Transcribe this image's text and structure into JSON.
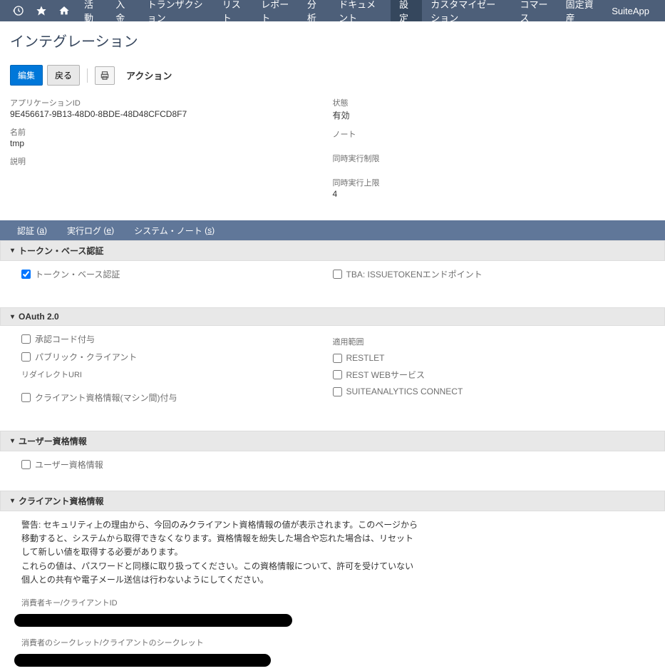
{
  "nav": {
    "items": [
      "活動",
      "入金",
      "トランザクション",
      "リスト",
      "レポート",
      "分析",
      "ドキュメント",
      "設定",
      "カスタマイゼーション",
      "コマース",
      "固定資産",
      "SuiteApp"
    ],
    "active_index": 7
  },
  "page": {
    "title": "インテグレーション"
  },
  "actions": {
    "edit": "編集",
    "back": "戻る",
    "action_menu": "アクション"
  },
  "fields": {
    "left": {
      "app_id_label": "アプリケーションID",
      "app_id_value": "9E456617-9B13-48D0-8BDE-48D48CFCD8F7",
      "name_label": "名前",
      "name_value": "tmp",
      "description_label": "説明",
      "description_value": ""
    },
    "right": {
      "state_label": "状態",
      "state_value": "有効",
      "note_label": "ノート",
      "note_value": "",
      "concurrency_limit_label": "同時実行制限",
      "concurrency_limit_value": "",
      "concurrency_max_label": "同時実行上限",
      "concurrency_max_value": "4"
    }
  },
  "subtabs": {
    "auth": "認証",
    "auth_key": "a",
    "exec_log": "実行ログ",
    "exec_log_key": "e",
    "sys_note": "システム・ノート",
    "sys_note_key": "s"
  },
  "sections": {
    "token_auth": {
      "title": "トークン・ベース認証",
      "cb_token": "トークン・ベース認証",
      "cb_tba_endpoint": "TBA: ISSUETOKENエンドポイント"
    },
    "oauth": {
      "title": "OAuth 2.0",
      "cb_auth_code": "承認コード付与",
      "cb_public_client": "パブリック・クライアント",
      "redirect_uri_label": "リダイレクトURI",
      "cb_client_cred": "クライアント資格情報(マシン間)付与",
      "scope_label": "適用範囲",
      "cb_restlet": "RESTLET",
      "cb_rest_web": "REST WEBサービス",
      "cb_suiteanalytics": "SUITEANALYTICS CONNECT"
    },
    "user_cred": {
      "title": "ユーザー資格情報",
      "cb_user_cred": "ユーザー資格情報"
    },
    "client_cred": {
      "title": "クライアント資格情報",
      "warning": "警告: セキュリティ上の理由から、今回のみクライアント資格情報の値が表示されます。このページから移動すると、システムから取得できなくなります。資格情報を紛失した場合や忘れた場合は、リセットして新しい値を取得する必要があります。\nこれらの値は、パスワードと同様に取り扱ってください。この資格情報について、許可を受けていない個人との共有や電子メール送信は行わないようにしてください。",
      "consumer_key_label": "消費者キー/クライアントID",
      "consumer_secret_label": "消費者のシークレット/クライアントのシークレット"
    }
  }
}
